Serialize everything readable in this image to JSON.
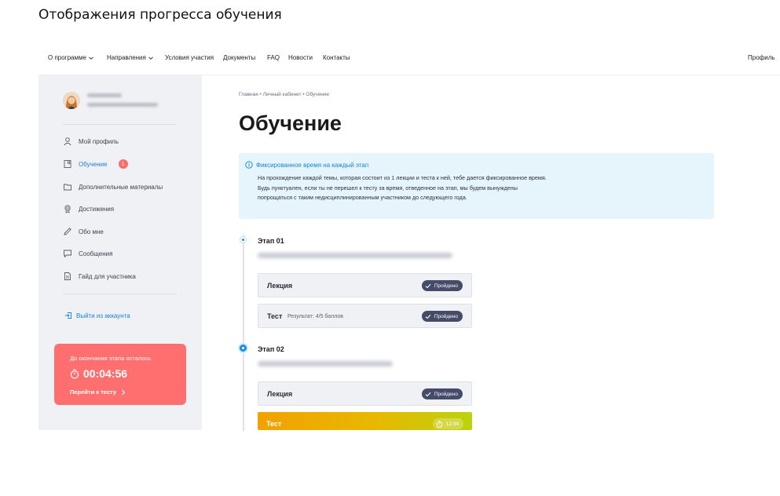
{
  "doc_title": "Отображения прогресса обучения",
  "topnav": {
    "items": [
      "О программе",
      "Направления",
      "Условия участия",
      "Документы",
      "FAQ",
      "Новости",
      "Контакты"
    ],
    "profile": "Профиль"
  },
  "sidebar": {
    "items": [
      {
        "label": "Мой профиль",
        "icon": "user-icon"
      },
      {
        "label": "Обучение",
        "icon": "book-icon",
        "badge": "1"
      },
      {
        "label": "Дополнительные материалы",
        "icon": "folder-icon"
      },
      {
        "label": "Достижения",
        "icon": "medal-icon"
      },
      {
        "label": "Обо мне",
        "icon": "pencil-icon"
      },
      {
        "label": "Сообщения",
        "icon": "message-icon"
      },
      {
        "label": "Гайд для участника",
        "icon": "document-icon"
      }
    ],
    "logout": "Выйти из аккаунта",
    "timer": {
      "label": "До окончания этапа осталось",
      "time": "00:04:56",
      "link": "Перейти к тесту"
    }
  },
  "breadcrumb": "Главная  •  Личный кабинет  •  Обучение",
  "page_title": "Обучение",
  "info": {
    "title": "Фиксированное время на каждый этап",
    "text": "На прохождение каждой темы, которая состоит из 1 лекции и теста к ней, тебе дается фиксированное время. Будь пунктуален, если ты не перешел к тесту за время, отведенное на этап, мы будем вынуждены попрощаться с таким недисциплинированным участником до следующего года."
  },
  "stages": [
    {
      "title": "Этап 01",
      "cards": [
        {
          "name": "Лекция",
          "status": "Пройдено"
        },
        {
          "name": "Тест",
          "result": "Результат: 4/5 баллов",
          "status": "Пройдено"
        }
      ]
    },
    {
      "title": "Этап 02",
      "cards": [
        {
          "name": "Лекция",
          "status": "Пройдено"
        },
        {
          "name": "Тест",
          "time": "12:34"
        }
      ]
    }
  ],
  "colors": {
    "accent": "#1a8fe0",
    "timer_bg": "#ff6f6f",
    "pill_bg": "#454b68",
    "info_bg": "#e6f4fb"
  }
}
